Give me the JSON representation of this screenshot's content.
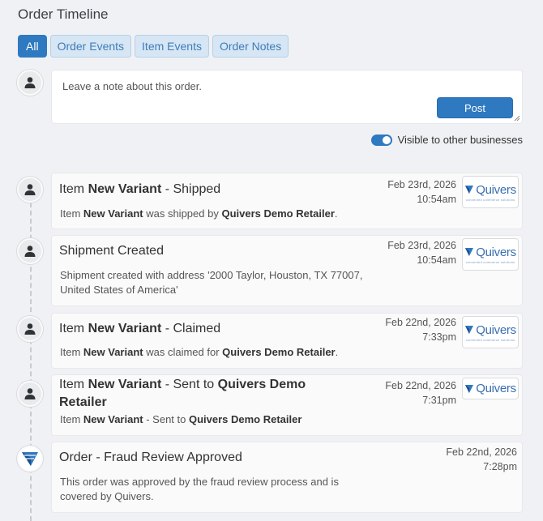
{
  "page": {
    "title": "Order Timeline"
  },
  "tabs": [
    {
      "label": "All",
      "active": true
    },
    {
      "label": "Order Events",
      "active": false
    },
    {
      "label": "Item Events",
      "active": false
    },
    {
      "label": "Order Notes",
      "active": false
    }
  ],
  "note": {
    "placeholder": "Leave a note about this order.",
    "post_label": "Post",
    "visibility_label": "Visible to other businesses",
    "visibility_on": true
  },
  "logo": {
    "name": "Quivers",
    "tagline": "connected commerce solutions"
  },
  "events": [
    {
      "title_pre": "Item ",
      "title_bold": "New Variant",
      "title_post": " - Shipped",
      "title_bold2": "",
      "title_post2": "",
      "body_pre": "Item ",
      "body_bold": "New Variant",
      "body_mid": " was shipped by ",
      "body_bold2": "Quivers Demo Retailer",
      "body_post": ".",
      "date": "Feb 23rd, 2026",
      "time": "10:54am"
    },
    {
      "title_pre": "Shipment Created",
      "title_bold": "",
      "title_post": "",
      "title_bold2": "",
      "title_post2": "",
      "body_pre": "Shipment created with address '2000 Taylor, Houston, TX 77007, United States of America'",
      "body_bold": "",
      "body_mid": "",
      "body_bold2": "",
      "body_post": "",
      "date": "Feb 23rd, 2026",
      "time": "10:54am"
    },
    {
      "title_pre": "Item ",
      "title_bold": "New Variant",
      "title_post": " - Claimed",
      "title_bold2": "",
      "title_post2": "",
      "body_pre": "Item ",
      "body_bold": "New Variant",
      "body_mid": " was claimed for ",
      "body_bold2": "Quivers Demo Retailer",
      "body_post": ".",
      "date": "Feb 22nd, 2026",
      "time": "7:33pm"
    },
    {
      "title_pre": "Item ",
      "title_bold": "New Variant",
      "title_post": " - Sent to ",
      "title_bold2": "Quivers Demo Retailer",
      "title_post2": "",
      "body_pre": "Item ",
      "body_bold": "New Variant",
      "body_mid": " - Sent to ",
      "body_bold2": "Quivers Demo Retailer",
      "body_post": "",
      "date": "Feb 22nd, 2026",
      "time": "7:31pm"
    },
    {
      "title_pre": "Order - Fraud Review Approved",
      "title_bold": "",
      "title_post": "",
      "title_bold2": "",
      "title_post2": "",
      "body_pre": "This order was approved by the fraud review process and is covered by Quivers.",
      "body_bold": "",
      "body_mid": "",
      "body_bold2": "",
      "body_post": "",
      "date": "Feb 22nd, 2026",
      "time": "7:28pm"
    }
  ],
  "colors": {
    "accent": "#2f79c1",
    "tab_bg": "#d6e6f5",
    "page_bg": "#f0f1f4"
  }
}
